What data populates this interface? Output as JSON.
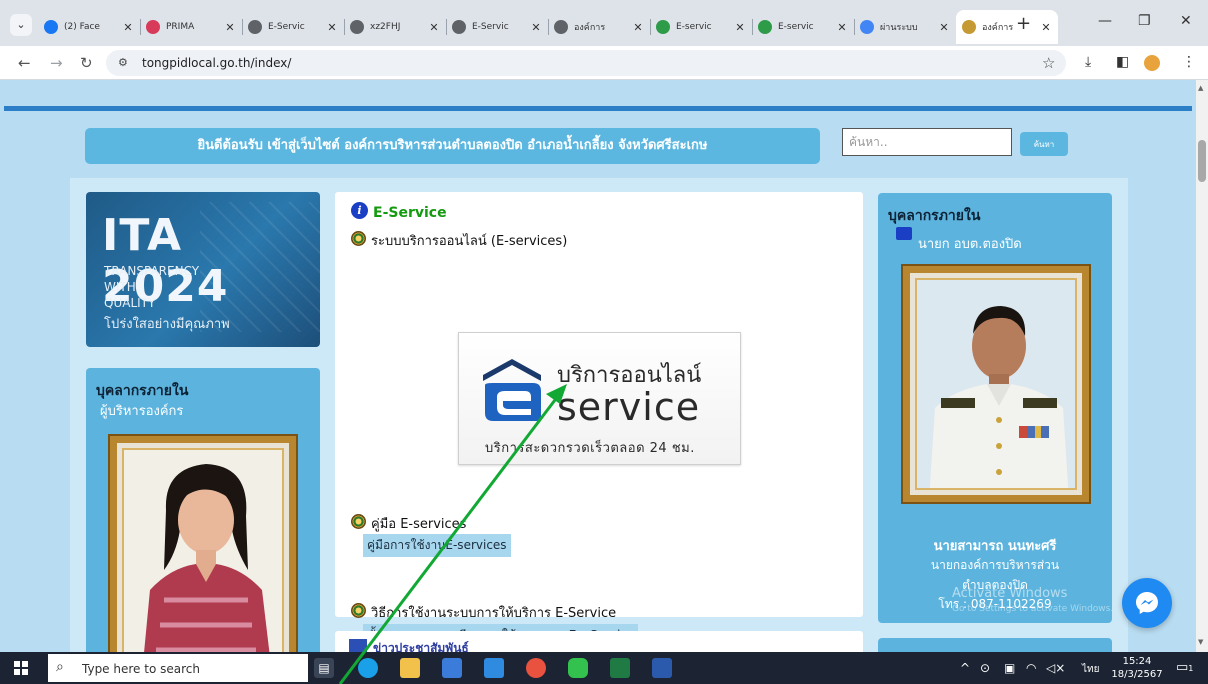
{
  "browser": {
    "tabs": [
      {
        "title": "(2) Face",
        "icon": "facebook-icon",
        "color": "#1877f2"
      },
      {
        "title": "PRIMA",
        "icon": "prima-icon",
        "color": "#d83b5a"
      },
      {
        "title": "E-Servic",
        "icon": "globe-icon",
        "color": "#5f6368"
      },
      {
        "title": "xz2FHJ",
        "icon": "globe-icon",
        "color": "#5f6368"
      },
      {
        "title": "E-Servic",
        "icon": "globe-icon",
        "color": "#5f6368"
      },
      {
        "title": "องค์การ",
        "icon": "globe-icon",
        "color": "#5f6368"
      },
      {
        "title": "E-servic",
        "icon": "e-icon",
        "color": "#2e9b48"
      },
      {
        "title": "E-servic",
        "icon": "e-icon",
        "color": "#2e9b48"
      },
      {
        "title": "ผ่านระบบ",
        "icon": "google-icon",
        "color": "#4285f4"
      },
      {
        "title": "องค์การ",
        "icon": "seal-icon",
        "color": "#c59a34",
        "active": true
      }
    ],
    "url": "tongpidlocal.go.th/index/"
  },
  "page": {
    "welcome": "ยินดีต้อนรับ เข้าสู่เว็บไซต์ องค์การบริหารส่วนตำบลตองปิด อำเภอน้ำเกลี้ยง จังหวัดศรีสะเกษ",
    "search": {
      "placeholder": "ค้นหา..",
      "button": "ค้นหา"
    },
    "ita": {
      "title": "ITA 2024",
      "line1": "TRANSPARENCY",
      "line2": "WITH",
      "line3": "QUALITY",
      "line4": "โปร่งใสอย่างมีคุณภาพ"
    },
    "left_card": {
      "heading": "บุคลากรภายใน",
      "subtitle": "ผู้บริหารองค์กร"
    },
    "main": {
      "heading": "E-Service",
      "item1": "ระบบบริการออนไลน์ (E-services)",
      "banner": {
        "line1": "บริการออนไลน์",
        "line2": "service",
        "line3": "บริการสะดวกรวดเร็วตลอด 24 ชม."
      },
      "item2": "คู่มือ E-services",
      "item2_link": "คู่มือการใช้งานE-services",
      "item3": "วิธีการใช้งานระบบการให้บริการ E-Service",
      "item3_link": "ขั้นตอนการลงทะเบียนการใช้งานระบบ E – Service",
      "panel2_title": "ข่าวประชาสัมพันธ์"
    },
    "right_card": {
      "heading": "บุคลากรภายใน",
      "subtitle": "นายก อบต.ตองปิด",
      "name": "นายสามารถ นนทะศรี",
      "role1": "นายกองค์การบริหารส่วน",
      "role2": "ตำบลตองปิด",
      "phone": "โทร : 087-1102269"
    },
    "watermark": {
      "line1": "Activate Windows",
      "line2": "Go to Settings to activate Windows."
    }
  },
  "taskbar": {
    "search": "Type here to search",
    "lang": "ไทย",
    "time": "15:24",
    "date": "18/3/2567",
    "notif_count": "1"
  }
}
